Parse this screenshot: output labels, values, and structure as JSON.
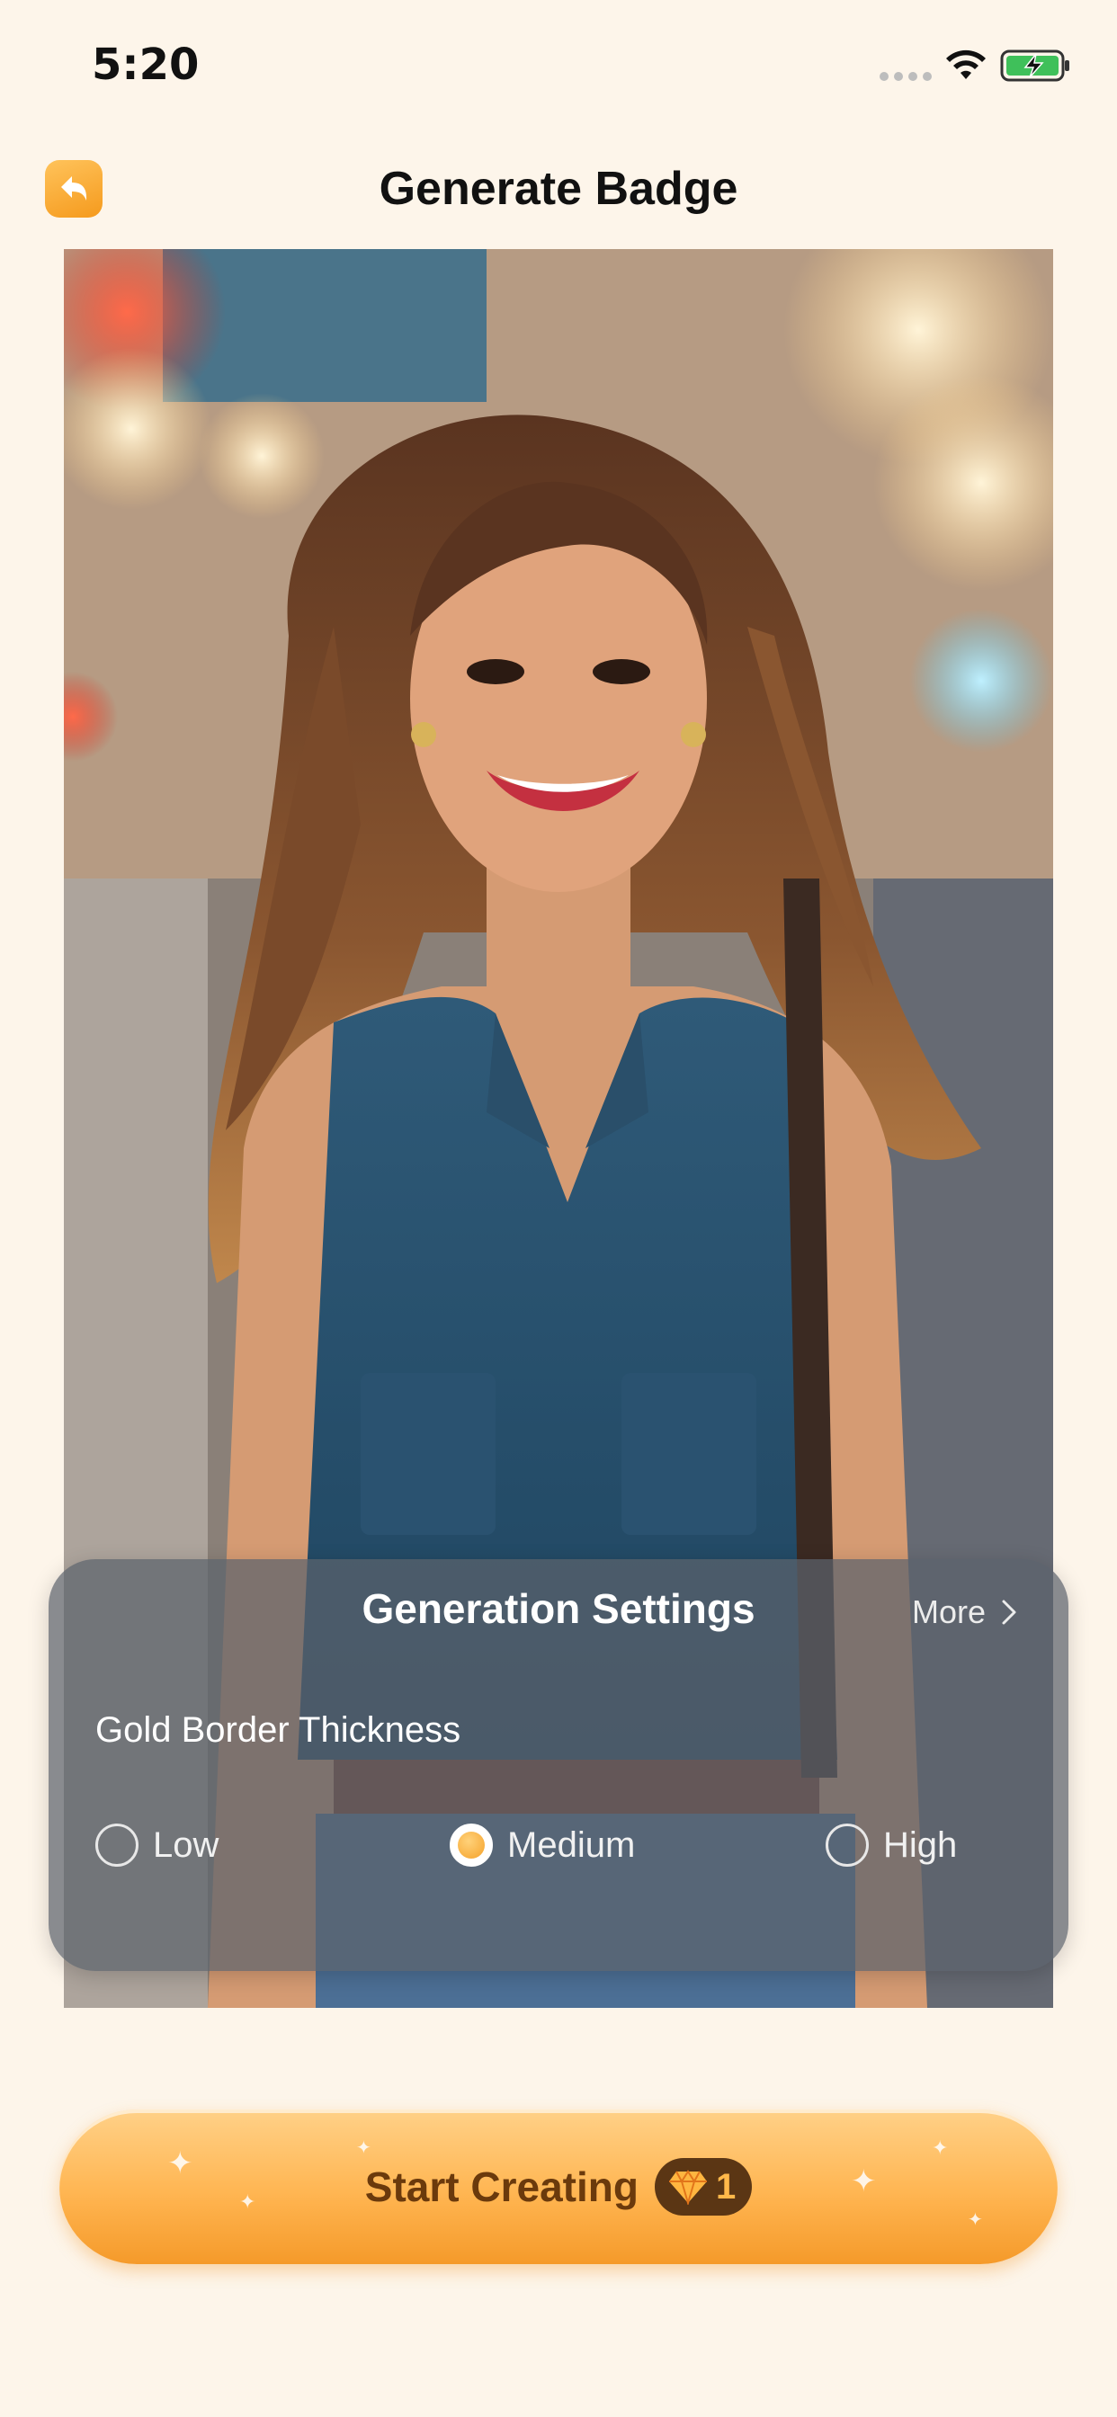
{
  "status_bar": {
    "time": "5:20"
  },
  "header": {
    "title": "Generate Badge"
  },
  "settings": {
    "title": "Generation Settings",
    "more_label": "More",
    "option_label": "Gold Border Thickness",
    "options": [
      {
        "label": "Low",
        "selected": false
      },
      {
        "label": "Medium",
        "selected": true
      },
      {
        "label": "High",
        "selected": false
      }
    ]
  },
  "cta": {
    "label": "Start Creating",
    "cost": "1"
  },
  "colors": {
    "accent": "#f5a22b",
    "background": "#fdf5ea",
    "cta_text": "#6b3a0c"
  },
  "icons": [
    "back-arrow-icon",
    "wifi-icon",
    "battery-charging-icon",
    "chevron-right-icon",
    "diamond-icon"
  ]
}
